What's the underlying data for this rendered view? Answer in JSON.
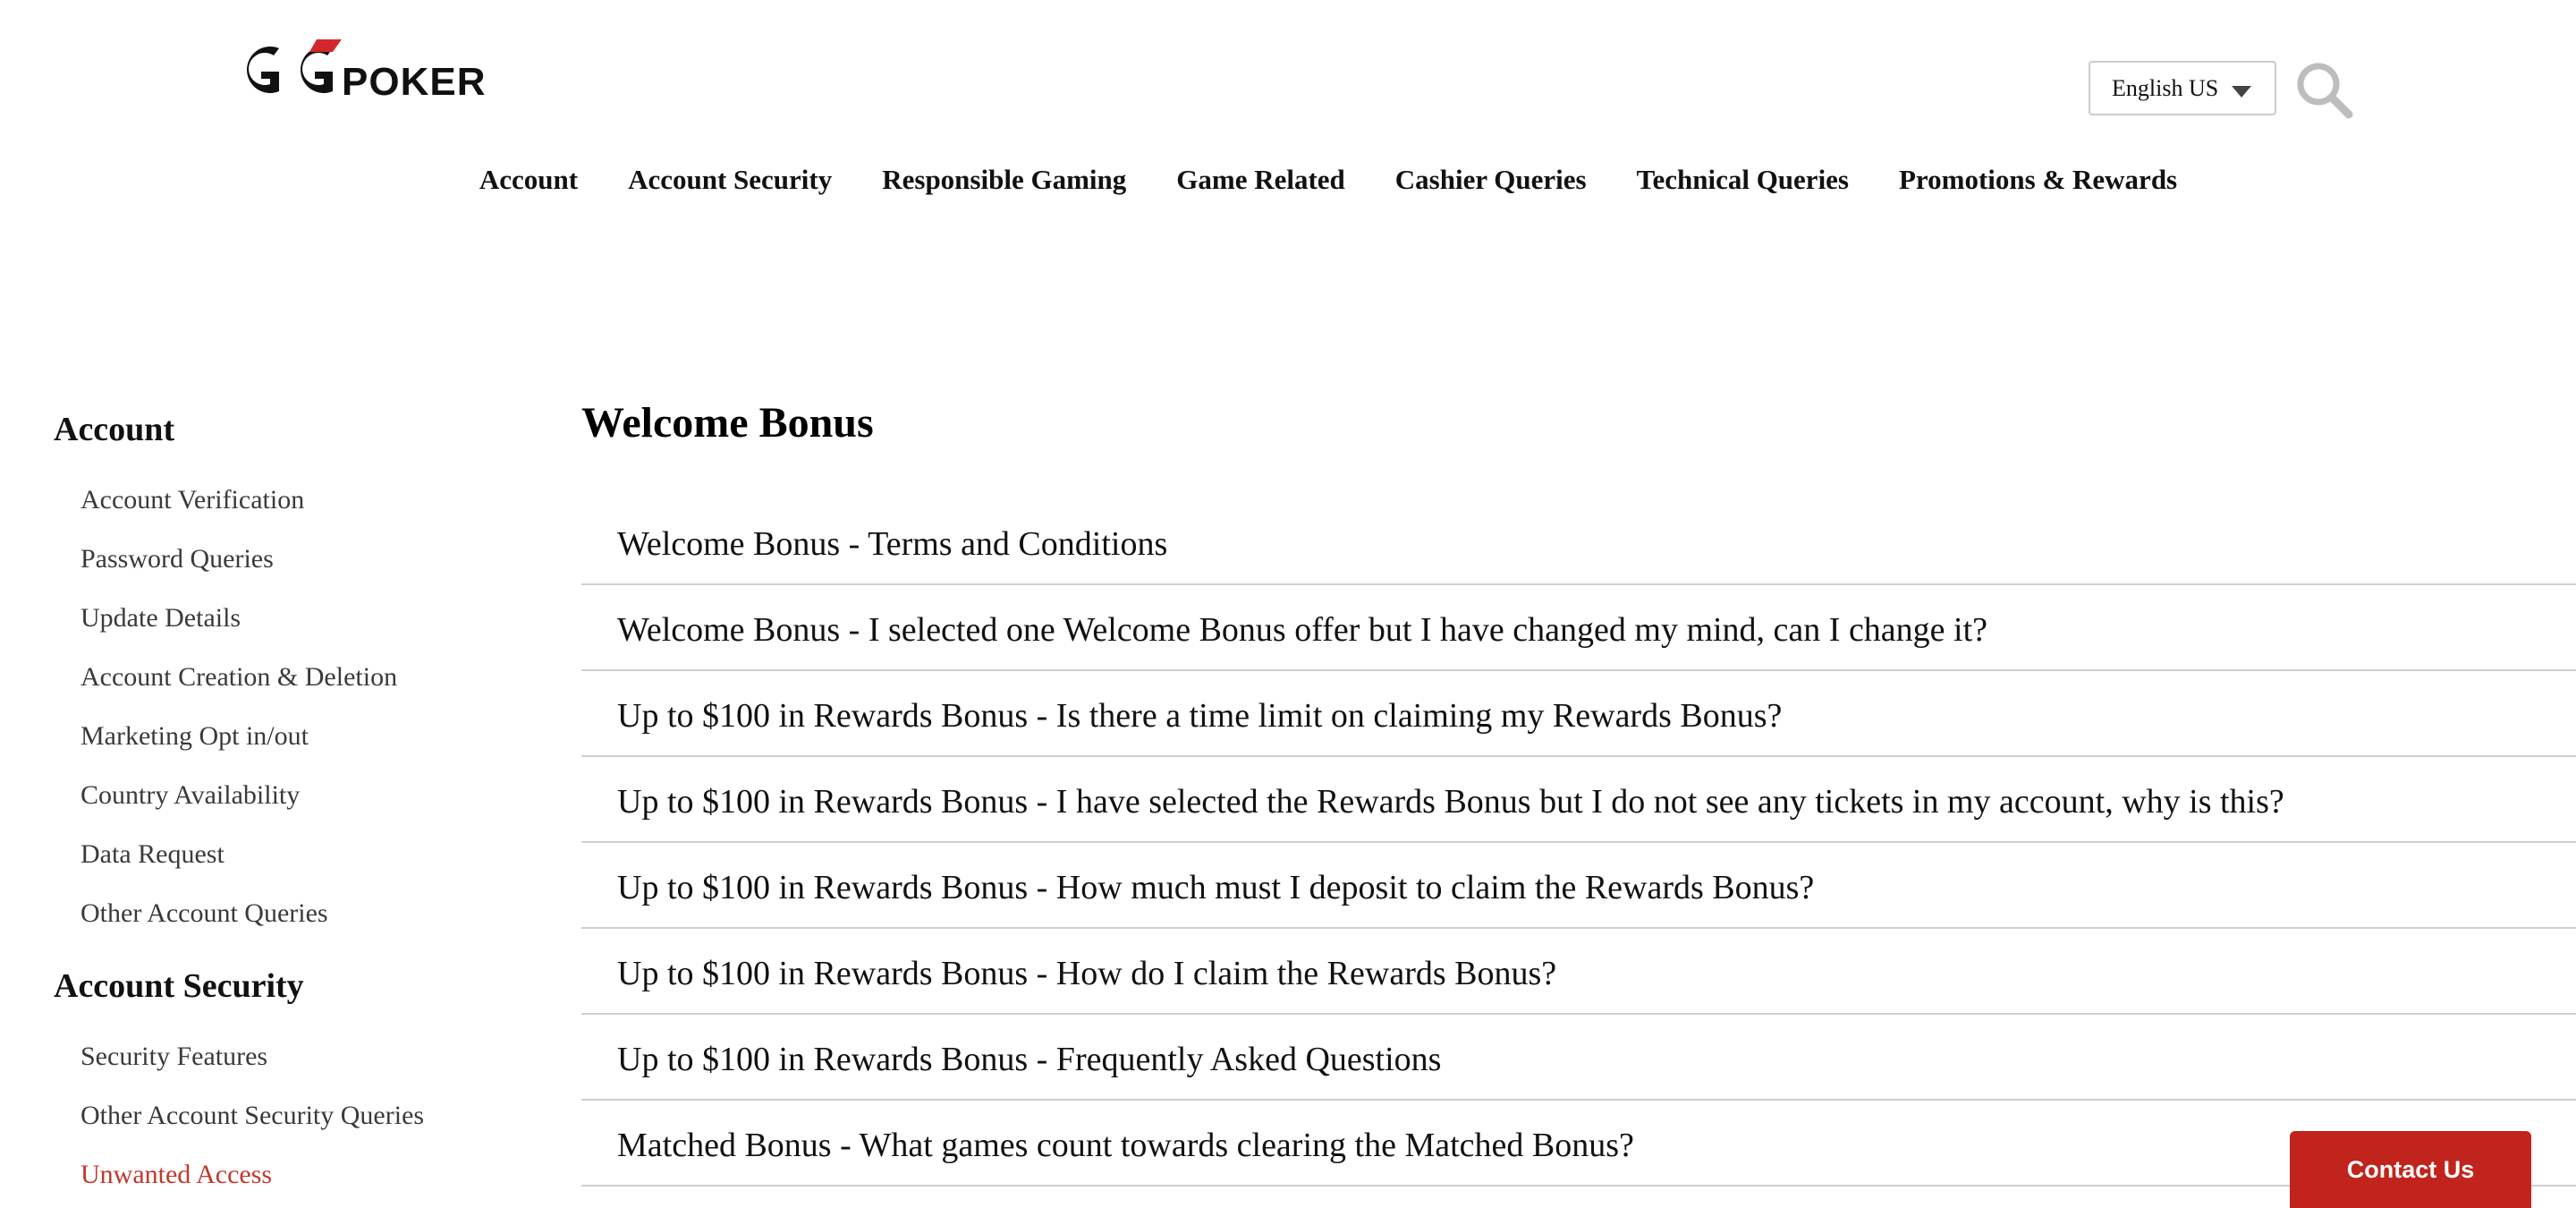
{
  "header": {
    "logo_text": "GGPOKER",
    "language": {
      "selected": "English US"
    },
    "icons": {
      "search": "search-icon",
      "dropdown": "chevron-down-icon"
    },
    "nav": [
      "Account",
      "Account Security",
      "Responsible Gaming",
      "Game Related",
      "Cashier Queries",
      "Technical Queries",
      "Promotions & Rewards"
    ]
  },
  "sidebar": {
    "groups": [
      {
        "title": "Account",
        "items": [
          "Account Verification",
          "Password Queries",
          "Update Details",
          "Account Creation & Deletion",
          "Marketing Opt in/out",
          "Country Availability",
          "Data Request",
          "Other Account Queries"
        ]
      },
      {
        "title": "Account Security",
        "items": [
          "Security Features",
          "Other Account Security Queries",
          "Unwanted Access"
        ]
      }
    ]
  },
  "main": {
    "title": "Welcome Bonus",
    "articles": [
      "Welcome Bonus - Terms and Conditions",
      "Welcome Bonus - I selected one Welcome Bonus offer but I have changed my mind, can I change it?",
      "Up to $100 in Rewards Bonus - Is there a time limit on claiming my Rewards Bonus?",
      "Up to $100 in Rewards Bonus - I have selected the Rewards Bonus but I do not see any tickets in my account, why is this?",
      "Up to $100 in Rewards Bonus - How much must I deposit to claim the Rewards Bonus?",
      "Up to $100 in Rewards Bonus - How do I claim the Rewards Bonus?",
      "Up to $100 in Rewards Bonus - Frequently Asked Questions",
      "Matched Bonus - What games count towards clearing the Matched Bonus?"
    ]
  },
  "contact": {
    "label": "Contact Us"
  },
  "colors": {
    "accent": "#c0241c",
    "active_link": "#c0392b",
    "logo_red": "#d2282d",
    "divider": "#cfcfcf"
  }
}
